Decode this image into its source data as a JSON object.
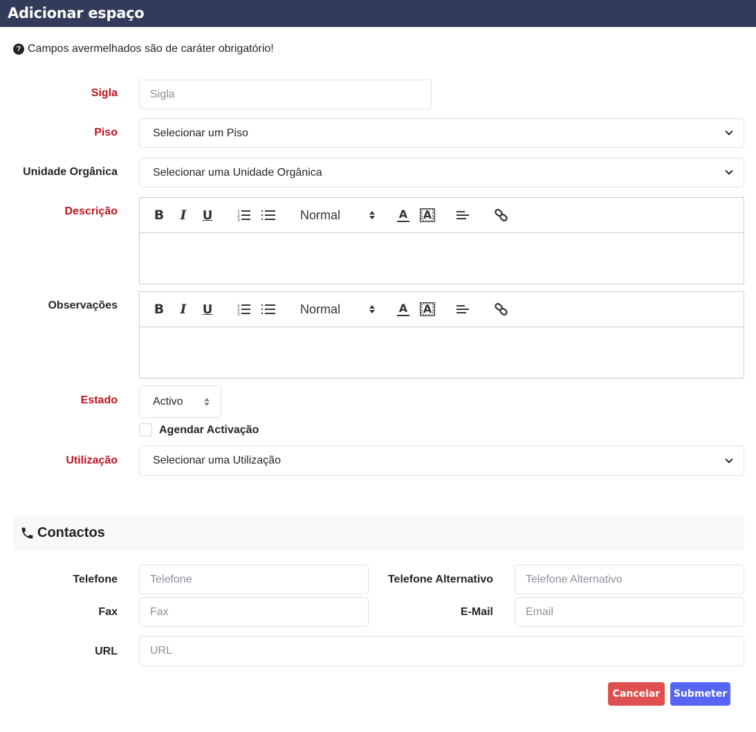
{
  "window": {
    "title": "Adicionar espaço"
  },
  "hint": {
    "text": "Campos avermelhados são de caráter obrigatório!"
  },
  "form": {
    "sigla": {
      "label": "Sigla",
      "placeholder": "Sigla"
    },
    "piso": {
      "label": "Piso",
      "selected": "Selecionar um Piso"
    },
    "unidade": {
      "label": "Unidade Orgânica",
      "selected": "Selecionar uma Unidade Orgânica"
    },
    "descricao": {
      "label": "Descrição"
    },
    "observacoes": {
      "label": "Observações"
    },
    "editor": {
      "bold": "B",
      "italic": "I",
      "underline": "U",
      "size": "Normal",
      "color_glyph": "A",
      "bg_glyph": "A"
    },
    "estado": {
      "label": "Estado",
      "selected": "Activo"
    },
    "agendar": {
      "label": "Agendar Activação",
      "checked": false
    },
    "utilizacao": {
      "label": "Utilização",
      "selected": "Selecionar uma Utilização"
    }
  },
  "contactos": {
    "title": "Contactos",
    "telefone": {
      "label": "Telefone",
      "placeholder": "Telefone"
    },
    "telefone_alt": {
      "label": "Telefone Alternativo",
      "placeholder": "Telefone Alternativo"
    },
    "fax": {
      "label": "Fax",
      "placeholder": "Fax"
    },
    "email": {
      "label": "E-Mail",
      "placeholder": "Email"
    },
    "url": {
      "label": "URL",
      "placeholder": "URL"
    }
  },
  "actions": {
    "cancel": "Cancelar",
    "submit": "Submeter"
  },
  "colors": {
    "titlebar": "#323b59",
    "required": "#c0131e",
    "cancel": "#df4f4f",
    "submit": "#5765f5"
  }
}
